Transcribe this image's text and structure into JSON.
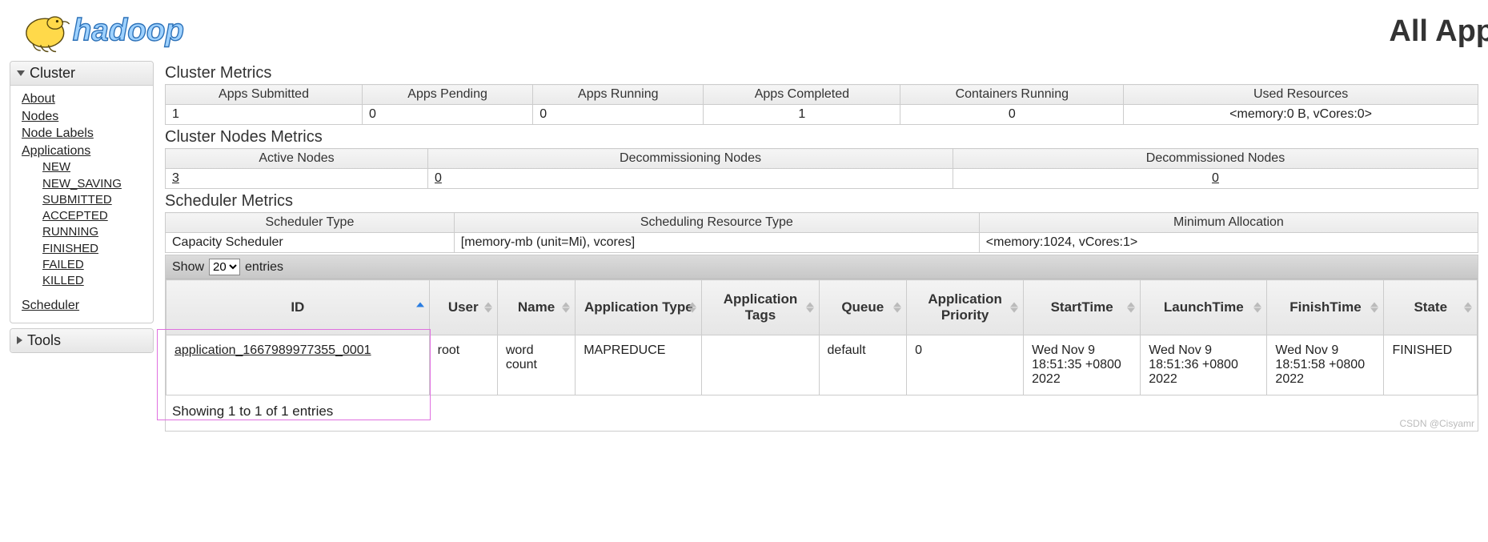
{
  "header": {
    "page_title": "All App"
  },
  "sidebar": {
    "cluster": {
      "title": "Cluster",
      "about": "About",
      "nodes": "Nodes",
      "node_labels": "Node Labels",
      "applications": "Applications",
      "states": [
        "NEW",
        "NEW_SAVING",
        "SUBMITTED",
        "ACCEPTED",
        "RUNNING",
        "FINISHED",
        "FAILED",
        "KILLED"
      ],
      "scheduler": "Scheduler"
    },
    "tools": {
      "title": "Tools"
    }
  },
  "cluster_metrics": {
    "title": "Cluster Metrics",
    "headers": [
      "Apps Submitted",
      "Apps Pending",
      "Apps Running",
      "Apps Completed",
      "Containers Running",
      "Used Resources"
    ],
    "values": [
      "1",
      "0",
      "0",
      "1",
      "0",
      "<memory:0 B, vCores:0>"
    ]
  },
  "cluster_nodes_metrics": {
    "title": "Cluster Nodes Metrics",
    "headers": [
      "Active Nodes",
      "Decommissioning Nodes",
      "Decommissioned Nodes"
    ],
    "values": [
      "3",
      "0",
      "0"
    ]
  },
  "scheduler_metrics": {
    "title": "Scheduler Metrics",
    "headers": [
      "Scheduler Type",
      "Scheduling Resource Type",
      "Minimum Allocation"
    ],
    "values": [
      "Capacity Scheduler",
      "[memory-mb (unit=Mi), vcores]",
      "<memory:1024, vCores:1>"
    ]
  },
  "apps_table": {
    "show_label_pre": "Show",
    "show_label_post": "entries",
    "show_value": "20",
    "headers": [
      "ID",
      "User",
      "Name",
      "Application Type",
      "Application Tags",
      "Queue",
      "Application Priority",
      "StartTime",
      "LaunchTime",
      "FinishTime",
      "State"
    ],
    "rows": [
      {
        "id": "application_1667989977355_0001",
        "user": "root",
        "name": "word count",
        "type": "MAPREDUCE",
        "tags": "",
        "queue": "default",
        "priority": "0",
        "start": "Wed Nov 9 18:51:35 +0800 2022",
        "launch": "Wed Nov 9 18:51:36 +0800 2022",
        "finish": "Wed Nov 9 18:51:58 +0800 2022",
        "state": "FINISHED"
      }
    ],
    "footer": "Showing 1 to 1 of 1 entries"
  },
  "credit": "CSDN @Cisyamr"
}
